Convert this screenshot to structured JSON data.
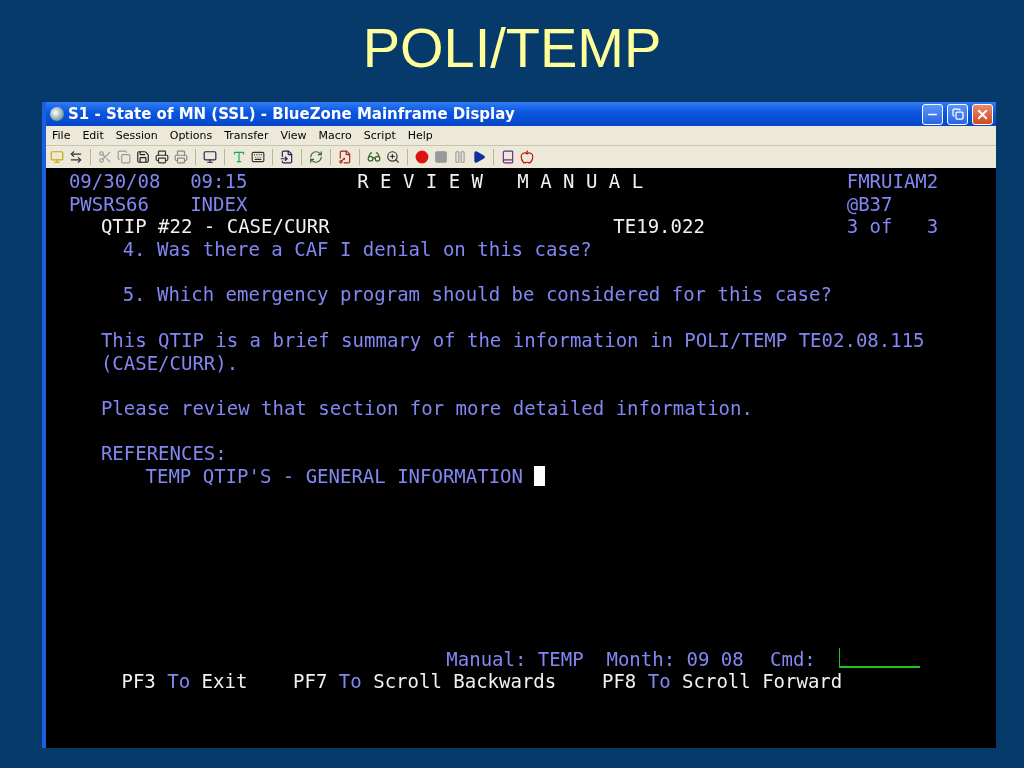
{
  "slide_title": "POLI/TEMP",
  "window": {
    "title": "S1 - State of MN (SSL) - BlueZone Mainframe Display"
  },
  "menu": [
    "File",
    "Edit",
    "Session",
    "Options",
    "Transfer",
    "View",
    "Macro",
    "Script",
    "Help"
  ],
  "terminal": {
    "header": {
      "date": "09/30/08",
      "time": "09:15",
      "title": "R E V I E W   M A N U A L",
      "screen_id": "FMRUIAM2",
      "user_id": "PWSRS66",
      "section": "INDEX",
      "location": "@B37",
      "topic": "QTIP #22 - CASE/CURR",
      "doc_id": "TE19.022",
      "page": "3 of   3"
    },
    "blocks": [
      {
        "kind": "question",
        "lines": [
          "4. Was there a CAF I denial on this case?"
        ]
      },
      {
        "kind": "question",
        "lines": [
          "5. Which emergency program should be considered for this case?"
        ]
      },
      {
        "kind": "text",
        "lines": [
          "This QTIP is a brief summary of the information in POLI/TEMP TE02.08.115",
          "(CASE/CURR)."
        ]
      },
      {
        "kind": "text",
        "lines": [
          "Please review that section for more detailed information."
        ]
      },
      {
        "kind": "references",
        "heading": "REFERENCES:",
        "items": [
          {
            "text": "TEMP QTIP'S - GENERAL INFORMATION",
            "cursor": true
          }
        ]
      }
    ],
    "status": {
      "manual_label": "Manual:",
      "manual": "TEMP",
      "month_label": "Month:",
      "month": "09 08",
      "cmd_label": "Cmd:"
    },
    "function_keys": [
      {
        "key": "PF3",
        "to": "To",
        "action": "Exit"
      },
      {
        "key": "PF7",
        "to": "To",
        "action": "Scroll Backwards"
      },
      {
        "key": "PF8",
        "to": "To",
        "action": "Scroll Forward"
      }
    ]
  }
}
